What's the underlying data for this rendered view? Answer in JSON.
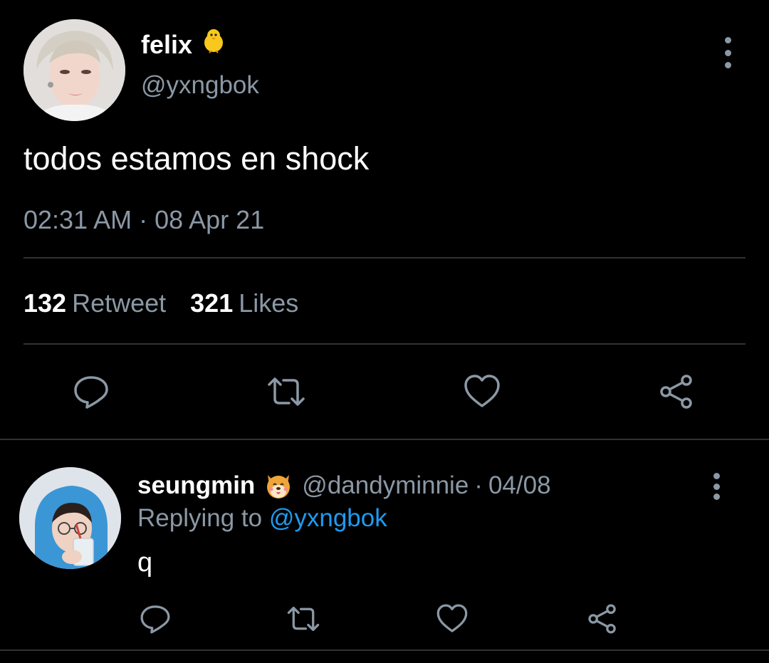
{
  "main_tweet": {
    "author_name": "felix",
    "author_emoji": "🐥",
    "handle": "@yxngbok",
    "text": "todos estamos en shock",
    "timestamp": "02:31 AM · 08 Apr 21",
    "retweet_count": "132",
    "retweet_label": "Retweet",
    "like_count": "321",
    "like_label": "Likes",
    "actions": [
      "reply-icon",
      "retweet-icon",
      "like-icon",
      "share-icon"
    ]
  },
  "reply_tweet": {
    "author_name": "seungmin",
    "author_emoji": "🐶",
    "handle": "@dandyminnie",
    "separator": "·",
    "date": "04/08",
    "replying_prefix": "Replying to",
    "replying_to": "@yxngbok",
    "text": "q",
    "actions": [
      "reply-icon",
      "retweet-icon",
      "like-icon",
      "share-icon"
    ]
  },
  "colors": {
    "background": "#000000",
    "text_primary": "#ffffff",
    "text_secondary": "#8b98a5",
    "divider": "#2f3336",
    "link": "#1d9bf0"
  }
}
